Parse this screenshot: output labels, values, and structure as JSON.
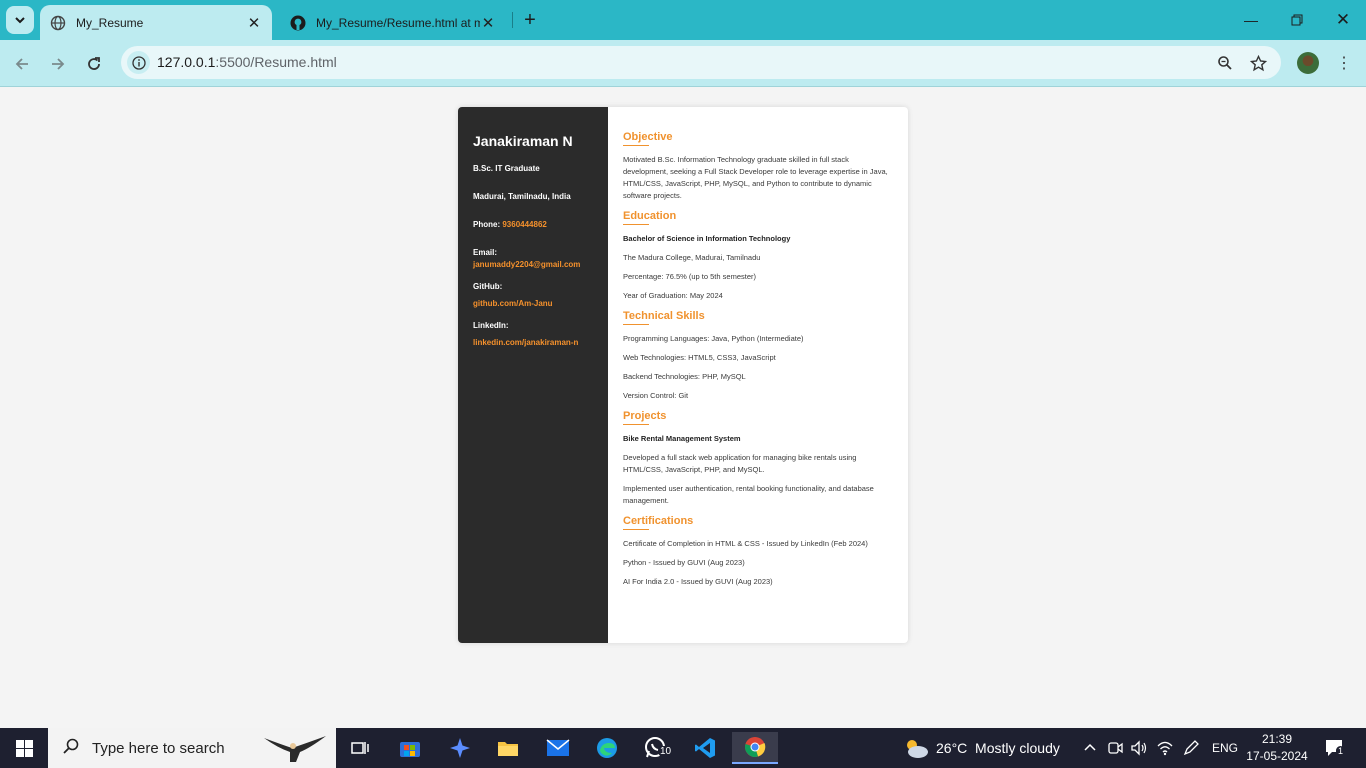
{
  "browser": {
    "tabs": [
      {
        "title": "My_Resume",
        "active": true
      },
      {
        "title": "My_Resume/Resume.html at main",
        "active": false
      }
    ],
    "url_host": "127.0.0.1",
    "url_path": ":5500/Resume.html"
  },
  "resume": {
    "name": "Janakiraman N",
    "degree": "B.Sc. IT Graduate",
    "location": "Madurai, Tamilnadu, India",
    "phone_label": "Phone:",
    "phone": "9360444862",
    "email_label": "Email:",
    "email": "janumaddy2204@gmail.com",
    "github_label": "GitHub:",
    "github": "github.com/Am-Janu",
    "linkedin_label": "LinkedIn:",
    "linkedin": "linkedin.com/janakiraman-n",
    "objective": {
      "heading": "Objective",
      "text": "Motivated B.Sc. Information Technology graduate skilled in full stack development, seeking a Full Stack Developer role to leverage expertise in Java, HTML/CSS, JavaScript, PHP, MySQL, and Python to contribute to dynamic software projects."
    },
    "education": {
      "heading": "Education",
      "degree": "Bachelor of Science in Information Technology",
      "college": "The Madura College, Madurai, Tamilnadu",
      "percentage": "Percentage: 76.5% (up to 5th semester)",
      "year": "Year of Graduation: May 2024"
    },
    "skills": {
      "heading": "Technical Skills",
      "items": [
        "Programming Languages: Java, Python (Intermediate)",
        "Web Technologies: HTML5, CSS3, JavaScript",
        "Backend Technologies: PHP, MySQL",
        "Version Control: Git"
      ]
    },
    "projects": {
      "heading": "Projects",
      "title": "Bike Rental Management System",
      "items": [
        "Developed a full stack web application for managing bike rentals using HTML/CSS, JavaScript, PHP, and MySQL.",
        "Implemented user authentication, rental booking functionality, and database management."
      ]
    },
    "certifications": {
      "heading": "Certifications",
      "items": [
        "Certificate of Completion in HTML & CSS - Issued by LinkedIn (Feb 2024)",
        "Python - Issued by GUVI (Aug 2023)",
        "AI For India 2.0 - Issued by GUVI (Aug 2023)"
      ]
    }
  },
  "taskbar": {
    "search_placeholder": "Type here to search",
    "whatsapp_badge": "10",
    "weather": "26°C  Mostly cloudy",
    "language": "ENG",
    "time": "21:39",
    "date": "17-05-2024",
    "notifications": "1"
  },
  "colors": {
    "accent": "#f0922e",
    "sidebar_bg": "#2b2b2b",
    "chrome_tab": "#2bb7c6",
    "chrome_toolbar": "#bdebf0"
  }
}
